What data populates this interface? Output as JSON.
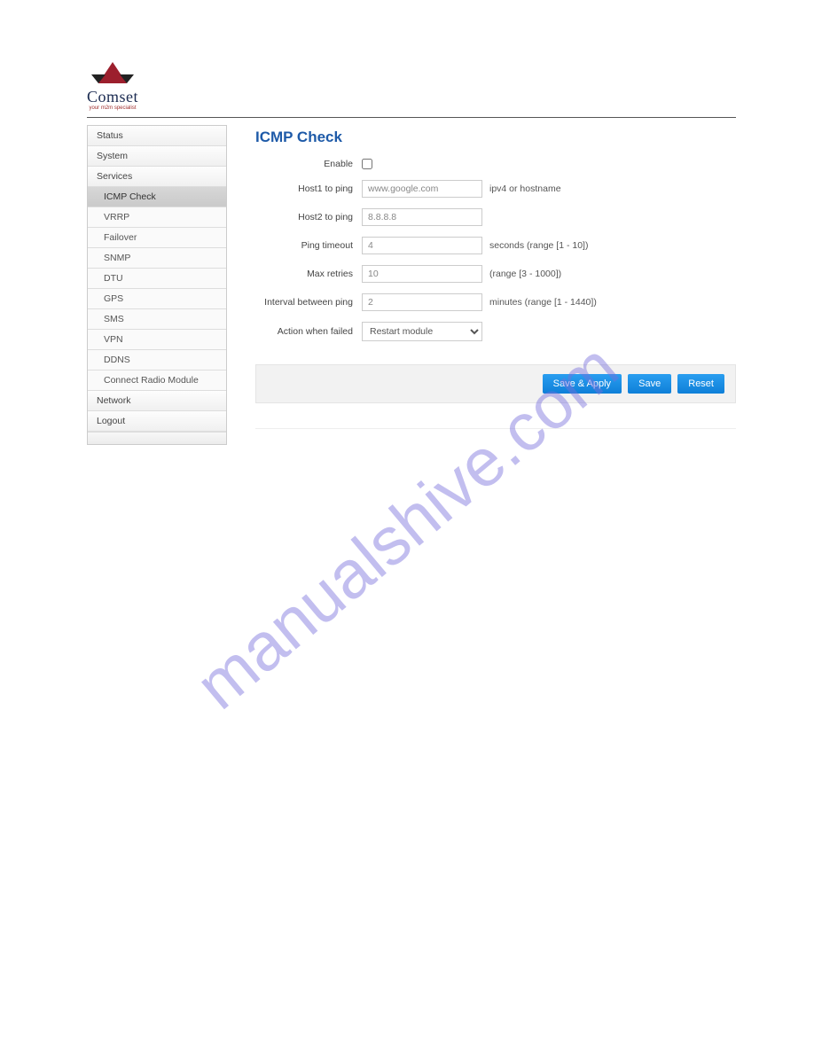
{
  "brand": {
    "name": "Comset",
    "tagline": "your m2m specialist"
  },
  "watermark": "manualshive.com",
  "sidebar": {
    "items": [
      {
        "label": "Status",
        "sub": false,
        "active": false
      },
      {
        "label": "System",
        "sub": false,
        "active": false
      },
      {
        "label": "Services",
        "sub": false,
        "active": false
      },
      {
        "label": "ICMP Check",
        "sub": true,
        "active": true
      },
      {
        "label": "VRRP",
        "sub": true,
        "active": false
      },
      {
        "label": "Failover",
        "sub": true,
        "active": false
      },
      {
        "label": "SNMP",
        "sub": true,
        "active": false
      },
      {
        "label": "DTU",
        "sub": true,
        "active": false
      },
      {
        "label": "GPS",
        "sub": true,
        "active": false
      },
      {
        "label": "SMS",
        "sub": true,
        "active": false
      },
      {
        "label": "VPN",
        "sub": true,
        "active": false
      },
      {
        "label": "DDNS",
        "sub": true,
        "active": false
      },
      {
        "label": "Connect Radio Module",
        "sub": true,
        "active": false
      },
      {
        "label": "Network",
        "sub": false,
        "active": false
      },
      {
        "label": "Logout",
        "sub": false,
        "active": false
      }
    ]
  },
  "page": {
    "title": "ICMP Check"
  },
  "form": {
    "enable": {
      "label": "Enable",
      "checked": false
    },
    "host1": {
      "label": "Host1 to ping",
      "value": "www.google.com",
      "hint": "ipv4 or hostname"
    },
    "host2": {
      "label": "Host2 to ping",
      "value": "8.8.8.8",
      "hint": ""
    },
    "timeout": {
      "label": "Ping timeout",
      "value": "4",
      "hint": "seconds (range [1 - 10])"
    },
    "retries": {
      "label": "Max retries",
      "value": "10",
      "hint": "(range [3 - 1000])"
    },
    "interval": {
      "label": "Interval between ping",
      "value": "2",
      "hint": "minutes (range [1 - 1440])"
    },
    "action": {
      "label": "Action when failed",
      "selected": "Restart module"
    }
  },
  "buttons": {
    "save_apply": "Save & Apply",
    "save": "Save",
    "reset": "Reset"
  }
}
